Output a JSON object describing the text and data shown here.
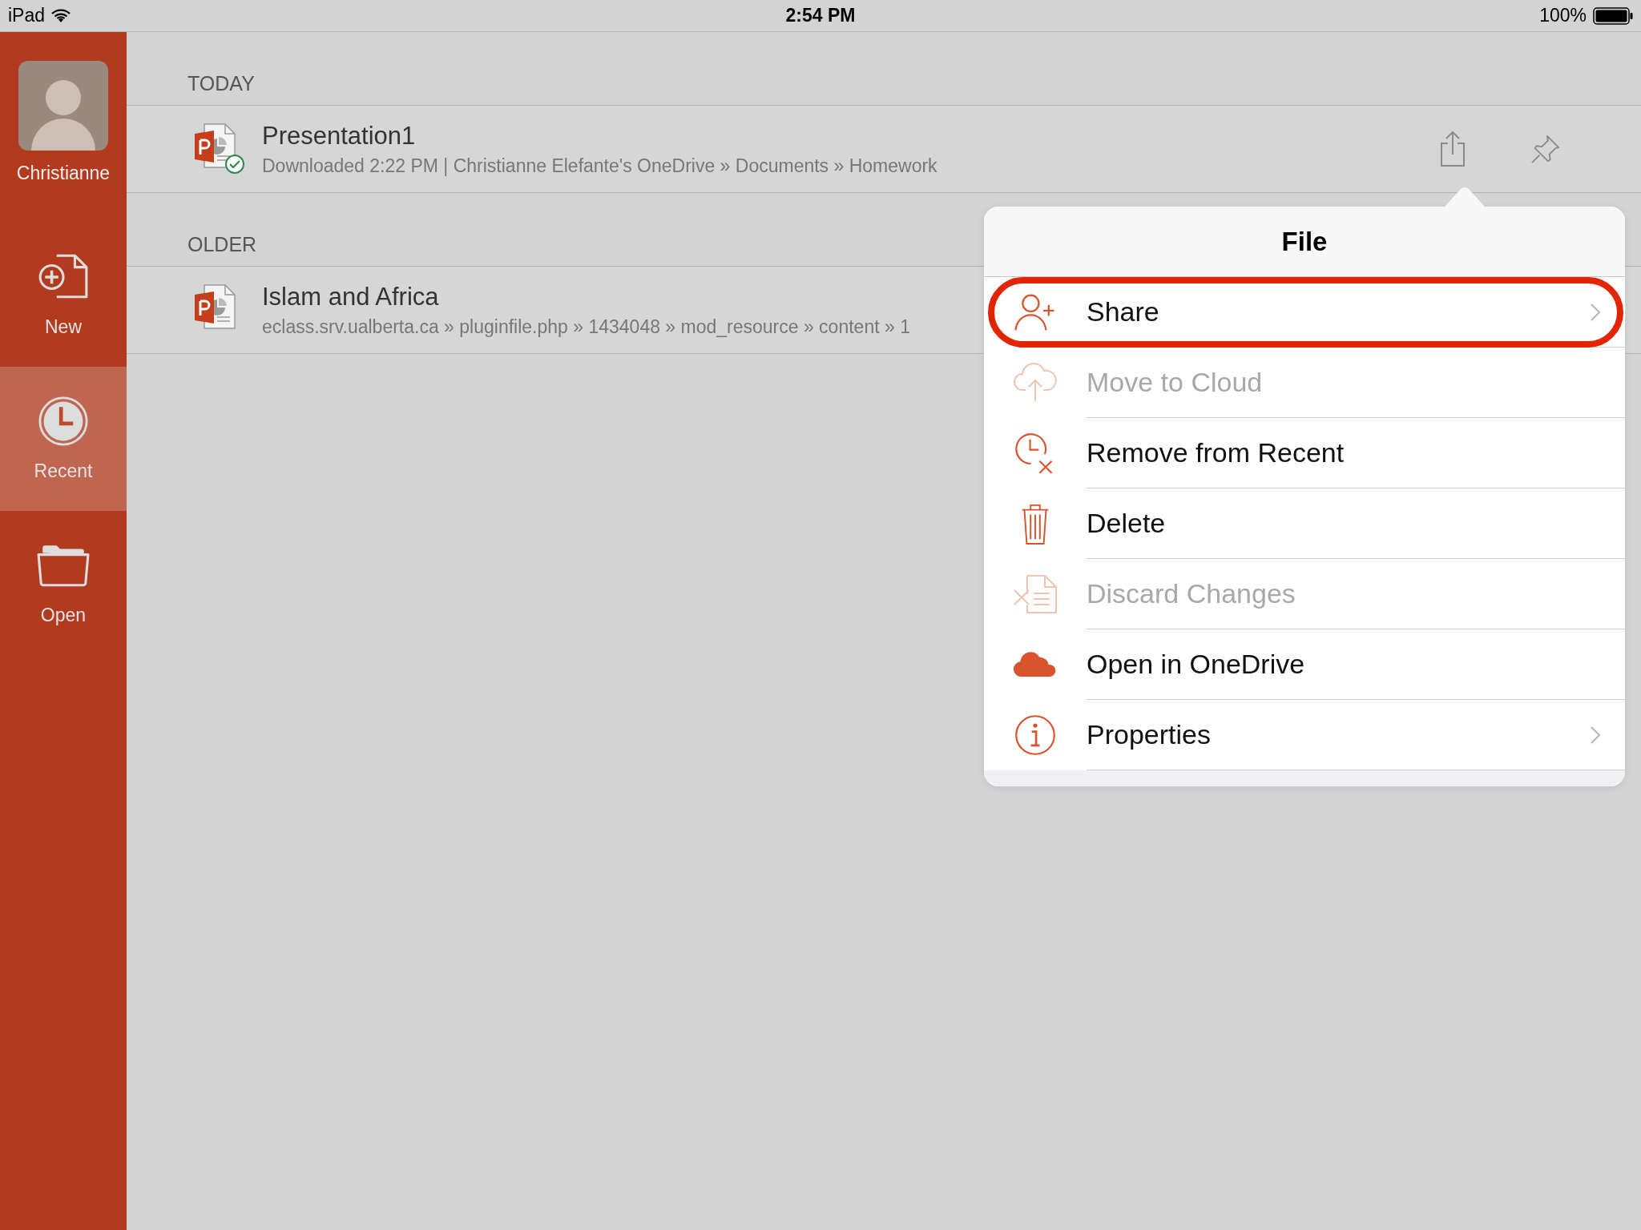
{
  "status_bar": {
    "device": "iPad",
    "time": "2:54 PM",
    "battery": "100%"
  },
  "sidebar": {
    "user": {
      "name": "Christianne"
    },
    "items": [
      {
        "kind": "new",
        "label": "New",
        "selected": false
      },
      {
        "kind": "recent",
        "label": "Recent",
        "selected": true
      },
      {
        "kind": "open",
        "label": "Open",
        "selected": false
      }
    ]
  },
  "sections": [
    {
      "label": "TODAY",
      "files": [
        {
          "name": "Presentation1",
          "detail": "Downloaded 2:22 PM | Christianne Elefante's OneDrive » Documents » Homework",
          "synced": true,
          "actions_shown": true
        }
      ]
    },
    {
      "label": "OLDER",
      "files": [
        {
          "name": "Islam and Africa",
          "detail": "eclass.srv.ualberta.ca » pluginfile.php » 1434048 » mod_resource » content » 1",
          "synced": false
        }
      ]
    }
  ],
  "popover": {
    "title": "File",
    "items": [
      {
        "kind": "share",
        "label": "Share",
        "disabled": false,
        "chevron": true,
        "highlighted": true
      },
      {
        "kind": "cloud-upload",
        "label": "Move to Cloud",
        "disabled": true,
        "chevron": false,
        "highlighted": false
      },
      {
        "kind": "remove-recent",
        "label": "Remove from Recent",
        "disabled": false,
        "chevron": false,
        "highlighted": false
      },
      {
        "kind": "delete",
        "label": "Delete",
        "disabled": false,
        "chevron": false,
        "highlighted": false
      },
      {
        "kind": "discard",
        "label": "Discard Changes",
        "disabled": true,
        "chevron": false,
        "highlighted": false
      },
      {
        "kind": "onedrive",
        "label": "Open in OneDrive",
        "disabled": false,
        "chevron": false,
        "highlighted": false
      },
      {
        "kind": "info",
        "label": "Properties",
        "disabled": false,
        "chevron": true,
        "highlighted": false
      }
    ]
  }
}
